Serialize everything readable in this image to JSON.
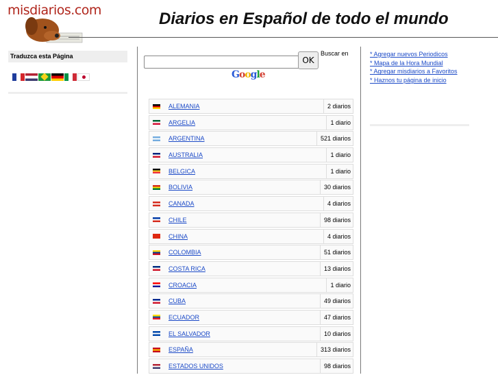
{
  "header": {
    "logo_text": "misdiarios.com",
    "title": "Diarios en Español de todo el mundo"
  },
  "sidebar": {
    "translate_label": "Traduzca esta Página",
    "flags": [
      {
        "name": "france-flag-icon",
        "colors": [
          "#1f3d9c",
          "#ffffff",
          "#d4262b"
        ]
      },
      {
        "name": "usa-flag-icon",
        "colors": [
          "#b22234",
          "#ffffff",
          "#3c3b6e"
        ]
      },
      {
        "name": "brazil-flag-icon",
        "colors": [
          "#1e9a3b",
          "#f6d31a",
          "#1f3d9c"
        ]
      },
      {
        "name": "germany-flag-icon",
        "colors": [
          "#000000",
          "#dd0000",
          "#ffce00"
        ]
      },
      {
        "name": "italy-flag-icon",
        "colors": [
          "#009246",
          "#ffffff",
          "#ce2b37"
        ]
      },
      {
        "name": "japan-flag-icon",
        "colors": [
          "#ffffff",
          "#bc002d"
        ]
      }
    ]
  },
  "search": {
    "input_value": "",
    "ok_label": "OK",
    "buscar_label": "Buscar en",
    "google_letters": [
      "G",
      "o",
      "o",
      "g",
      "l",
      "e"
    ]
  },
  "countries": [
    {
      "name": "ALEMANIA",
      "count": "2 diarios",
      "colors": [
        "#000000",
        "#dd0000",
        "#ffce00"
      ]
    },
    {
      "name": "ARGELIA",
      "count": "1 diario",
      "colors": [
        "#006233",
        "#ffffff",
        "#d21034"
      ]
    },
    {
      "name": "ARGENTINA",
      "count": "521 diarios",
      "colors": [
        "#74acdf",
        "#ffffff",
        "#74acdf"
      ]
    },
    {
      "name": "AUSTRALIA",
      "count": "1 diario",
      "colors": [
        "#00247d",
        "#ffffff",
        "#cf142b"
      ]
    },
    {
      "name": "BELGICA",
      "count": "1 diario",
      "colors": [
        "#000000",
        "#fdda24",
        "#ef3340"
      ]
    },
    {
      "name": "BOLIVIA",
      "count": "30 diarios",
      "colors": [
        "#d52b1e",
        "#f9e300",
        "#007934"
      ]
    },
    {
      "name": "CANADA",
      "count": "4 diarios",
      "colors": [
        "#d52b1e",
        "#ffffff",
        "#d52b1e"
      ]
    },
    {
      "name": "CHILE",
      "count": "98 diarios",
      "colors": [
        "#0039a6",
        "#ffffff",
        "#d52b1e"
      ]
    },
    {
      "name": "CHINA",
      "count": "4 diarios",
      "colors": [
        "#de2910",
        "#de2910",
        "#de2910"
      ]
    },
    {
      "name": "COLOMBIA",
      "count": "51 diarios",
      "colors": [
        "#fcd116",
        "#003893",
        "#ce1126"
      ]
    },
    {
      "name": "COSTA RICA",
      "count": "13 diarios",
      "colors": [
        "#002b7f",
        "#ffffff",
        "#ce1126"
      ]
    },
    {
      "name": "CROACIA",
      "count": "1 diario",
      "colors": [
        "#ff0000",
        "#ffffff",
        "#171796"
      ]
    },
    {
      "name": "CUBA",
      "count": "49 diarios",
      "colors": [
        "#002a8f",
        "#ffffff",
        "#cf142b"
      ]
    },
    {
      "name": "ECUADOR",
      "count": "47 diarios",
      "colors": [
        "#ffdd00",
        "#034ea2",
        "#ed1c24"
      ]
    },
    {
      "name": "EL SALVADOR",
      "count": "10 diarios",
      "colors": [
        "#0047ab",
        "#ffffff",
        "#0047ab"
      ]
    },
    {
      "name": "ESPAÑA",
      "count": "313 diarios",
      "colors": [
        "#c60b1e",
        "#ffc400",
        "#c60b1e"
      ]
    },
    {
      "name": "ESTADOS UNIDOS",
      "count": "98 diarios",
      "colors": [
        "#b22234",
        "#ffffff",
        "#3c3b6e"
      ]
    }
  ],
  "right_links": [
    "* Agregar nuevos Periodicos",
    "* Mapa de la Hora Mundial",
    "* Agregar misdiarios a Favoritos",
    "* Haznos tu página de inicio"
  ]
}
